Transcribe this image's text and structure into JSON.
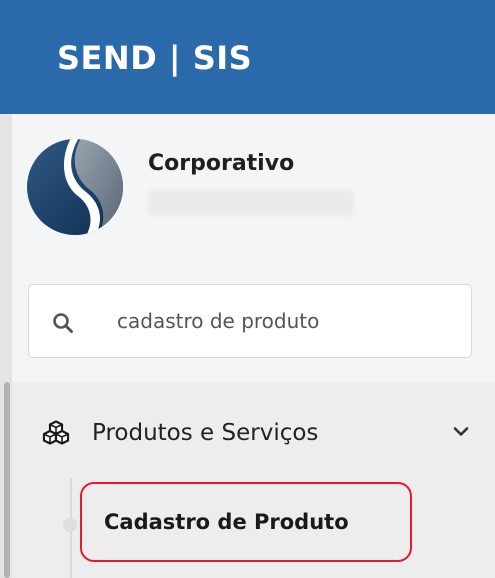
{
  "header": {
    "brand": "SEND | SIS",
    "background_color": "#2a6aab"
  },
  "user": {
    "avatar_icon": "company-logo-icon",
    "name": "Corporativo"
  },
  "search": {
    "icon": "search-icon",
    "value": "cadastro de produto"
  },
  "menu": {
    "group": {
      "icon": "cubes-icon",
      "label": "Produtos e Serviços",
      "expanded": true,
      "chevron_icon": "chevron-down-icon"
    },
    "items": [
      {
        "label": "Cadastro de Produto",
        "highlighted": true,
        "highlight_color": "#e8192c"
      }
    ]
  }
}
